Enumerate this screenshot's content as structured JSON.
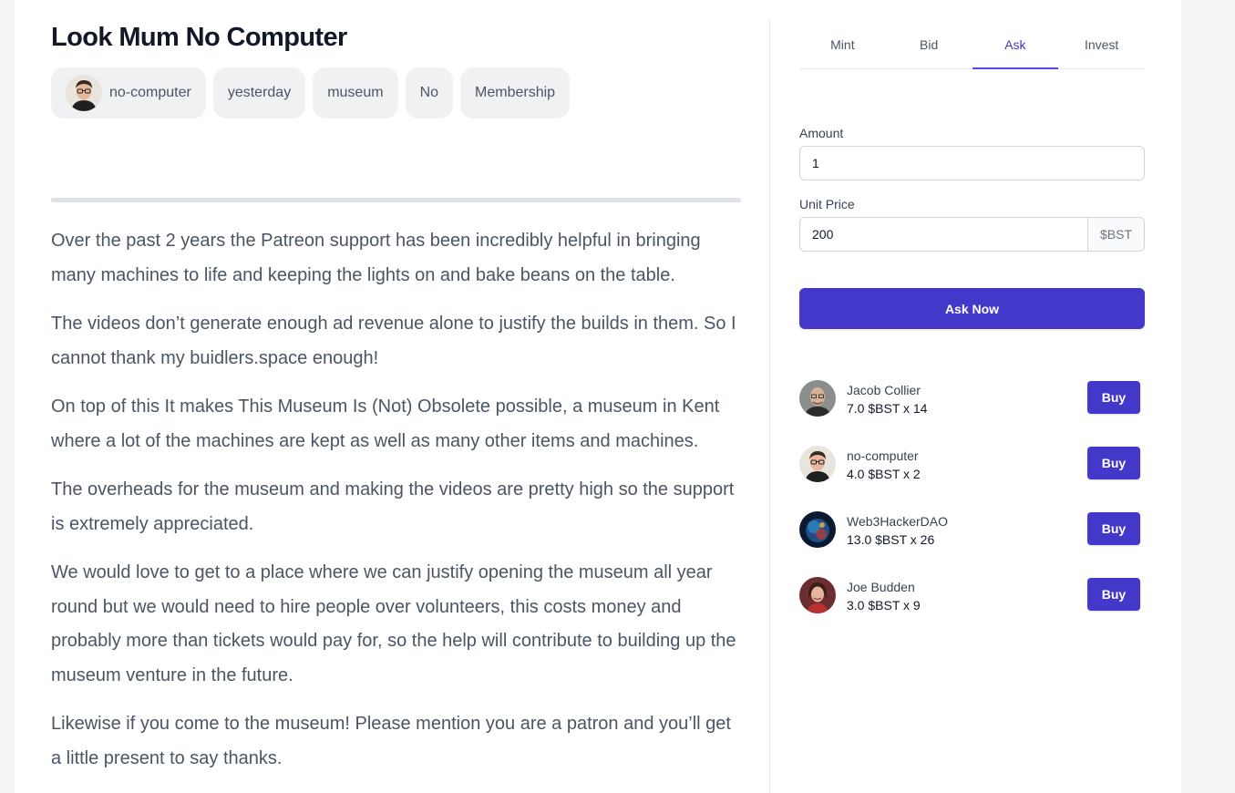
{
  "post": {
    "title": "Look Mum No Computer",
    "tags": {
      "author": "no-computer",
      "date": "yesterday",
      "category": "museum",
      "flag": "No",
      "access": "Membership"
    },
    "paragraphs": [
      "Over the past 2 years the Patreon support has been incredibly helpful in bringing many machines to life and keeping the lights on and bake beans on the table.",
      "The videos don’t generate enough ad revenue alone to justify the builds in them. So I cannot thank my buidlers.space enough!",
      "On top of this It makes This Museum Is (Not) Obsolete possible, a museum in Kent where a lot of the machines are kept as well as many other items and machines.",
      "The overheads for the museum and making the videos are pretty high so the support is extremely appreciated.",
      "We would love to get to a place where we can justify opening the museum all year round but we would need to hire people over volunteers, this costs money and probably more than tickets would pay for, so the help will contribute to building up the museum venture in the future.",
      "Likewise if you come to the museum! Please mention you are a patron and you’ll get a little present to say thanks."
    ]
  },
  "sidebar": {
    "tabs": [
      "Mint",
      "Bid",
      "Ask",
      "Invest"
    ],
    "active_tab": "Ask",
    "amount_label": "Amount",
    "amount_value": "1",
    "unit_price_label": "Unit Price",
    "unit_price_value": "200",
    "currency": "$BST",
    "submit_label": "Ask Now",
    "offers": [
      {
        "name": "Jacob Collier",
        "price": "7.0 $BST x 14",
        "button": "Buy",
        "avatar": "bald-man-avatar"
      },
      {
        "name": "no-computer",
        "price": "4.0 $BST x 2",
        "button": "Buy",
        "avatar": "glasses-man-avatar"
      },
      {
        "name": "Web3HackerDAO",
        "price": "13.0 $BST x 26",
        "button": "Buy",
        "avatar": "planet-avatar"
      },
      {
        "name": "Joe Budden",
        "price": "3.0 $BST x 9",
        "button": "Buy",
        "avatar": "woman-avatar"
      }
    ]
  },
  "colors": {
    "accent": "#4338ca",
    "tag_bg": "#f0f1f3",
    "body_text": "#4b5563"
  }
}
